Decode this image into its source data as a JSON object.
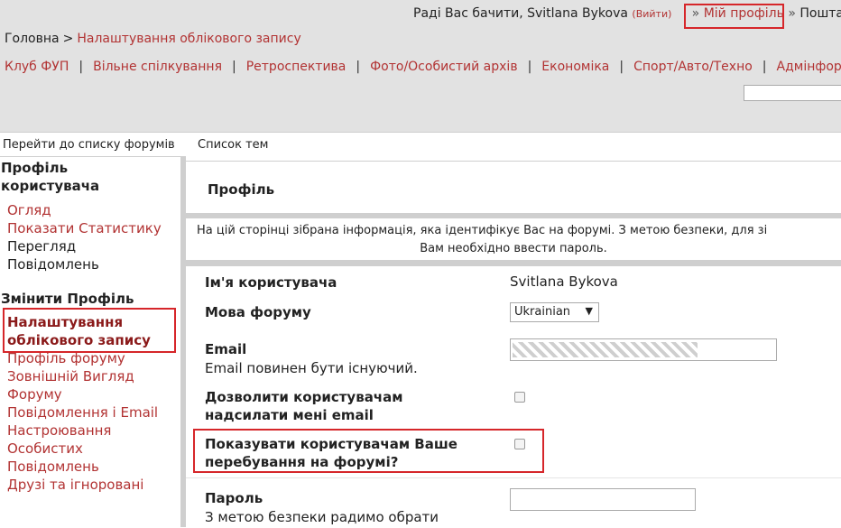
{
  "header": {
    "greeting": "Раді Вас бачити, Svitlana Bykova",
    "logout": "(Вийти)",
    "sep": "»",
    "my_profile": "Мій профіль",
    "mail": "Пошта"
  },
  "breadcrumb": {
    "home": "Головна",
    "gt": ">",
    "current": "Налаштування облікового запису"
  },
  "forum_nav": [
    "Клуб ФУП",
    "Вільне спілкування",
    "Ретроспектива",
    "Фото/Особистий архів",
    "Економіка",
    "Спорт/Авто/Техно",
    "Адмінфор"
  ],
  "forum_nav_sep": "|",
  "subnav": {
    "forums_list": "Перейти до списку форумів",
    "topics_list": "Список тем"
  },
  "sidebar": {
    "profile_heading": "Профіль користувача",
    "profile_heading_l1": "Профіль",
    "profile_heading_l2": "користувача",
    "overview": "Огляд",
    "show_stats": "Показати Статистику",
    "view_posts_l1": "Перегляд",
    "view_posts_l2": "Повідомлень",
    "edit_heading": "Змінити Профіль",
    "account_settings_l1": "Налаштування",
    "account_settings_l2": "облікового запису",
    "forum_profile": "Профіль форуму",
    "look_l1": "Зовнішній Вигляд",
    "look_l2": "Форуму",
    "notifications": "Повідомлення і Email",
    "pm_l1": "Настроювання",
    "pm_l2": "Особистих",
    "pm_l3": "Повідомлень",
    "buddies": "Друзі та ігноровані"
  },
  "main": {
    "title": "Профіль",
    "info_line1": "На цій сторінці зібрана інформація, яка ідентифікує Вас на форумі. З метою безпеки, для зі",
    "info_line2": "Вам необхідно ввести пароль.",
    "username_label": "Ім'я користувача",
    "username_value": "Svitlana Bykova",
    "language_label": "Мова форуму",
    "language_value": "Ukrainian",
    "email_label": "Email",
    "email_note": "Email повинен бути існуючий.",
    "allow_email_l1": "Дозволити користувачам",
    "allow_email_l2": "надсилати мені email",
    "show_online_l1": "Показувати користувачам Ваше",
    "show_online_l2": "перебування на форумі?",
    "password_label": "Пароль",
    "password_note": "З метою безпеки радимо обрати"
  },
  "colors": {
    "link": "#b23333",
    "highlight": "#d6262a",
    "band": "#e2e2e2"
  }
}
